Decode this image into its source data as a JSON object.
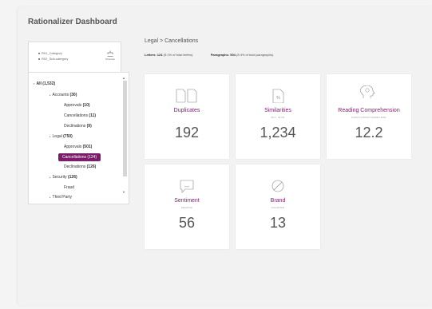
{
  "app": {
    "title": "Rationalizer Dashboard"
  },
  "structure": {
    "lines": [
      "R01_Category",
      "R02_Sub-category"
    ],
    "button_label": "Structure"
  },
  "tree": [
    {
      "prefix": "",
      "label": "All",
      "count": "(1,532)",
      "bold_label": true
    },
    {
      "prefix": "▸",
      "label": "Accounts",
      "count": "(30)",
      "bold_label": false
    },
    {
      "prefix": "",
      "label": "Approvals",
      "count": "(10)",
      "bold_label": false
    },
    {
      "prefix": "",
      "label": "Cancellations",
      "count": "(11)",
      "bold_label": false
    },
    {
      "prefix": "",
      "label": "Declinations",
      "count": "(9)",
      "bold_label": false
    },
    {
      "prefix": "▸",
      "label": "Legal",
      "count": "(750)",
      "bold_label": false
    },
    {
      "prefix": "",
      "label": "Approvals",
      "count": "(501)",
      "bold_label": false
    },
    {
      "prefix": "",
      "label": "Cancellations",
      "count": "(124)",
      "bold_label": false
    },
    {
      "prefix": "",
      "label": "Declinations",
      "count": "(126)",
      "bold_label": false
    },
    {
      "prefix": "▸",
      "label": "Security",
      "count": "(126)",
      "bold_label": false
    },
    {
      "prefix": "",
      "label": "Fraud",
      "count": "",
      "bold_label": false
    },
    {
      "prefix": "▸",
      "label": "Third Party",
      "count": "",
      "bold_label": false
    }
  ],
  "tree_scroll": {
    "up": "▲",
    "down": "▼"
  },
  "main": {
    "breadcrumb": "Legal > Cancellations",
    "letters_label": "Letters:",
    "letters_value": "124",
    "letters_note": "(8.1% of total letters)",
    "paragraphs_label": "Paragraphs:",
    "paragraphs_value": "504",
    "paragraphs_note": "(8.4% of total paragraphs)"
  },
  "metrics": [
    {
      "icon": "duplicate-docs-icon",
      "title": "Duplicates",
      "subtitle": "",
      "value": "192"
    },
    {
      "icon": "percent-doc-icon",
      "title": "Similarities",
      "subtitle": "80.0 - 99.0%",
      "value": "1,234"
    },
    {
      "icon": "brain-head-icon",
      "title": "Reading Comprehension",
      "subtitle": "FLESCH-KINCAID GRADE LEVEL",
      "value": "12.2"
    },
    {
      "icon": "chat-smile-icon",
      "title": "Sentiment",
      "subtitle": "NEGATIVE",
      "value": "56"
    },
    {
      "icon": "prohibited-icon",
      "title": "Brand",
      "subtitle": "VIOLATIONS",
      "value": "13"
    }
  ],
  "colors": {
    "accent": "#7b1d6b",
    "panel": "#f2f2f2",
    "card": "#ffffff"
  }
}
